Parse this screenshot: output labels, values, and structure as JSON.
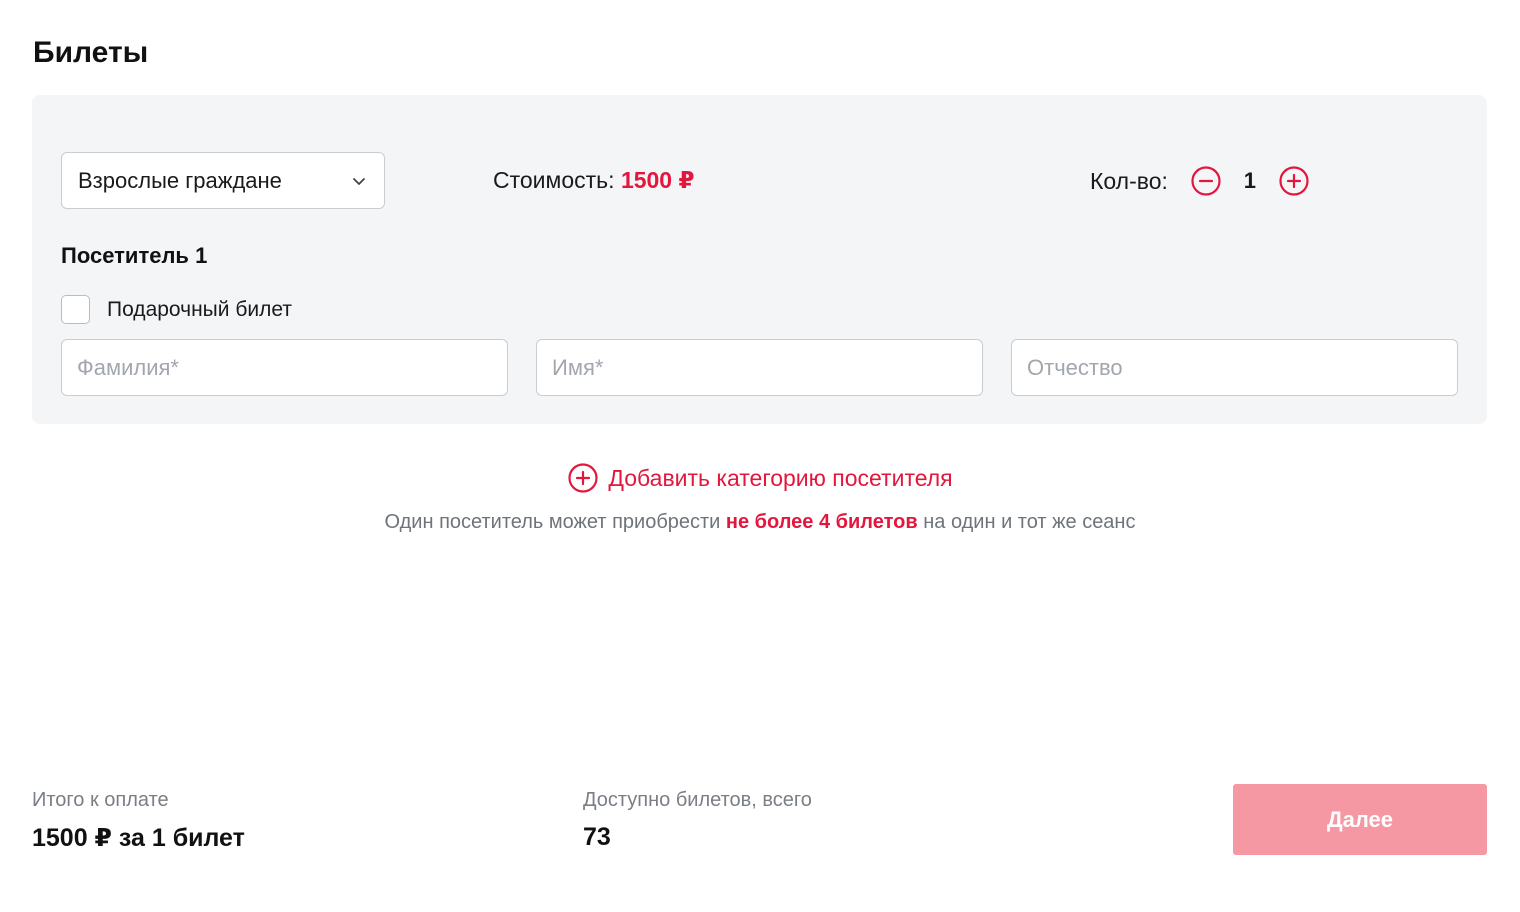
{
  "page": {
    "title": "Билеты"
  },
  "ticket": {
    "category": {
      "selected": "Взрослые граждане"
    },
    "price": {
      "label": "Стоимость:",
      "value": "1500 ₽"
    },
    "quantity": {
      "label": "Кол-во:",
      "value": "1"
    },
    "visitor": {
      "title": "Посетитель 1",
      "gift": {
        "label": "Подарочный билет",
        "checked": false
      },
      "fields": {
        "last_name": {
          "placeholder": "Фамилия*",
          "value": ""
        },
        "first_name": {
          "placeholder": "Имя*",
          "value": ""
        },
        "middle_name": {
          "placeholder": "Отчество",
          "value": ""
        }
      }
    }
  },
  "add_category": {
    "label": "Добавить категорию посетителя"
  },
  "limit_note": {
    "before": "Один посетитель может приобрести ",
    "highlight": "не более 4 билетов",
    "after": " на один и тот же сеанс"
  },
  "footer": {
    "total": {
      "label": "Итого к оплате",
      "value": "1500 ₽ за 1 билет"
    },
    "available": {
      "label": "Доступно билетов, всего",
      "value": "73"
    },
    "next_label": "Далее"
  },
  "colors": {
    "accent": "#e3173e",
    "button_disabled": "#f598a4",
    "card_background": "#f4f5f7"
  },
  "icons": {
    "select": "chevron-down-icon",
    "decrease": "minus-circle-icon",
    "increase": "plus-circle-icon",
    "add_category": "plus-circle-icon"
  }
}
